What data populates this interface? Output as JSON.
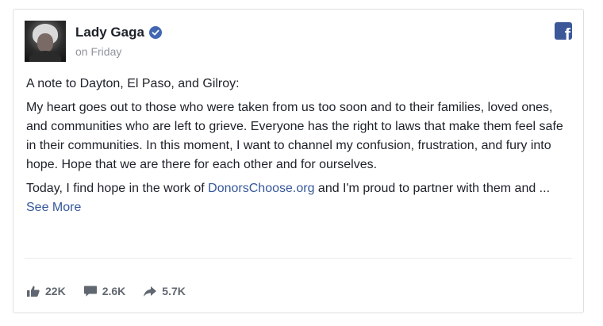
{
  "post": {
    "author": "Lady Gaga",
    "verified": true,
    "time": "on Friday",
    "paragraphs": {
      "p1": "A note to Dayton, El Paso, and Gilroy:",
      "p2": "My heart goes out to those who were taken from us too soon and to their families, loved ones, and communities who are left to grieve. Everyone has the right to laws that make them feel safe in their communities. In this moment, I want to channel my confusion, frustration, and fury into hope. Hope that we are there for each other and for ourselves.",
      "p3_before": "Today, I find hope in the work of ",
      "p3_link": "DonorsChoose.org",
      "p3_after": " and I'm proud to partner with them and ... ",
      "see_more": "See More"
    }
  },
  "stats": {
    "likes": "22K",
    "comments": "2.6K",
    "shares": "5.7K"
  },
  "icons": {
    "platform": "facebook-icon",
    "verified": "verified-badge-icon",
    "like": "thumbs-up-icon",
    "comment": "comment-icon",
    "share": "share-arrow-icon"
  },
  "colors": {
    "brand": "#3b5998",
    "link": "#365899",
    "verified": "#4267b2",
    "muted": "#90949c"
  }
}
